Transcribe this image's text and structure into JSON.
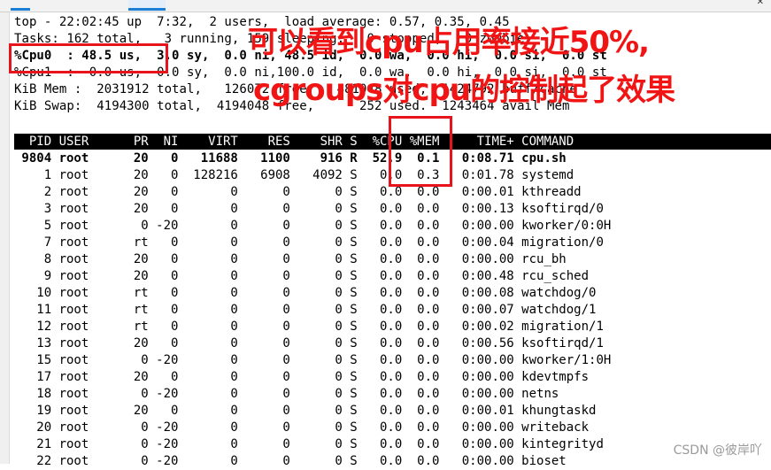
{
  "summary": {
    "line1": "top - 22:02:45 up  7:32,  2 users,  load average: 0.57, 0.35, 0.45",
    "line2": "Tasks: 162 total,   3 running, 159 sleeping,   0 stopped,   0 zombie",
    "line3": "%Cpu0  : 48.5 us,  3.0 sy,  0.0 ni, 48.5 id,  0.0 wa,  0.0 hi,  0.0 si,  0.0 st",
    "line4": "%Cpu1  :  0.0 us,  0.0 sy,  0.0 ni,100.0 id,  0.0 wa,  0.0 hi,  0.0 si,  0.0 st",
    "line5": "KiB Mem :  2031912 total,   126072 free,   481048 used,  1424792 buff/cache",
    "line6": "KiB Swap:  4194300 total,  4194048 free,      252 used.  1243464 avail Mem"
  },
  "table_header": "  PID USER      PR  NI    VIRT    RES    SHR S  %CPU %MEM     TIME+ COMMAND",
  "processes": [
    {
      "text": " 9804 root      20   0   11688   1100    916 R  52.9  0.1   0:08.71 cpu.sh",
      "bold": true
    },
    {
      "text": "    1 root      20   0  128216   6908   4092 S   0.0  0.3   0:01.78 systemd"
    },
    {
      "text": "    2 root      20   0       0      0      0 S   0.0  0.0   0:00.01 kthreadd"
    },
    {
      "text": "    3 root      20   0       0      0      0 S   0.0  0.0   0:00.13 ksoftirqd/0"
    },
    {
      "text": "    5 root       0 -20       0      0      0 S   0.0  0.0   0:00.00 kworker/0:0H"
    },
    {
      "text": "    7 root      rt   0       0      0      0 S   0.0  0.0   0:00.04 migration/0"
    },
    {
      "text": "    8 root      20   0       0      0      0 S   0.0  0.0   0:00.00 rcu_bh"
    },
    {
      "text": "    9 root      20   0       0      0      0 S   0.0  0.0   0:00.48 rcu_sched"
    },
    {
      "text": "   10 root      rt   0       0      0      0 S   0.0  0.0   0:00.08 watchdog/0"
    },
    {
      "text": "   11 root      rt   0       0      0      0 S   0.0  0.0   0:00.07 watchdog/1"
    },
    {
      "text": "   12 root      rt   0       0      0      0 S   0.0  0.0   0:00.02 migration/1"
    },
    {
      "text": "   13 root      20   0       0      0      0 S   0.0  0.0   0:00.56 ksoftirqd/1"
    },
    {
      "text": "   15 root       0 -20       0      0      0 S   0.0  0.0   0:00.00 kworker/1:0H"
    },
    {
      "text": "   17 root      20   0       0      0      0 S   0.0  0.0   0:00.00 kdevtmpfs"
    },
    {
      "text": "   18 root       0 -20       0      0      0 S   0.0  0.0   0:00.00 netns"
    },
    {
      "text": "   19 root      20   0       0      0      0 S   0.0  0.0   0:00.01 khungtaskd"
    },
    {
      "text": "   20 root       0 -20       0      0      0 S   0.0  0.0   0:00.00 writeback"
    },
    {
      "text": "   21 root       0 -20       0      0      0 S   0.0  0.0   0:00.00 kintegrityd"
    },
    {
      "text": "   22 root       0 -20       0      0      0 S   0.0  0.0   0:00.00 bioset"
    }
  ],
  "annotation": {
    "line1": "可以看到cpu占用率接近50%,",
    "line2": "cgroups对cpu的控制起了效果",
    "color": "#f01414"
  },
  "watermark": "CSDN @彼岸吖"
}
